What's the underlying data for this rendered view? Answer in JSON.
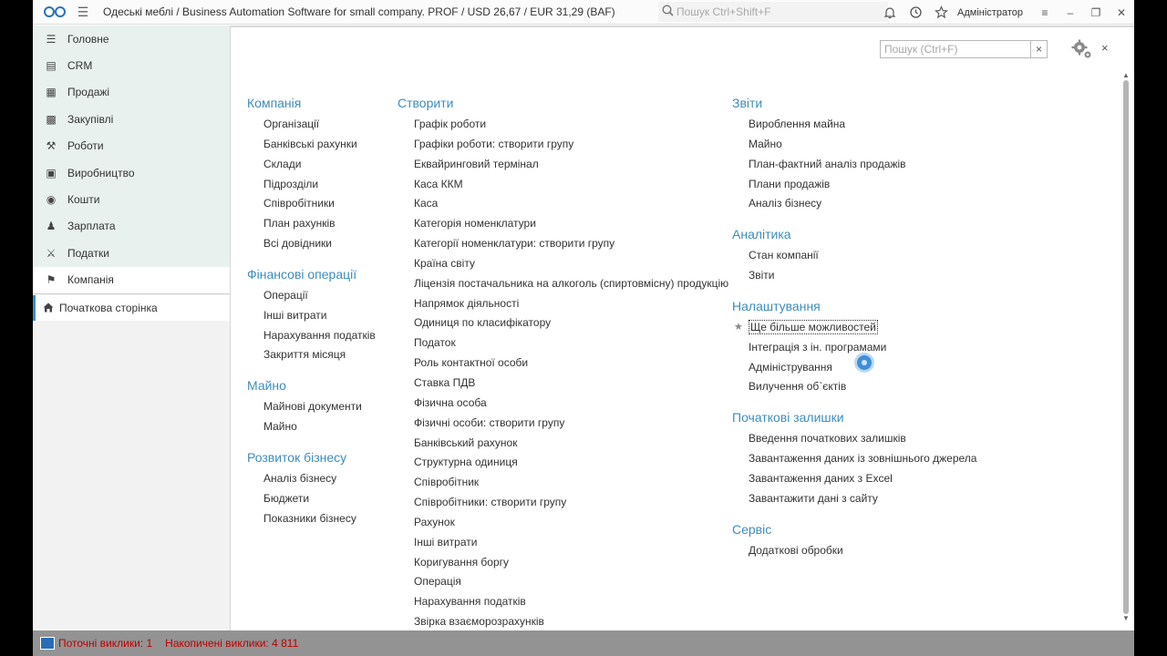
{
  "titlebar": {
    "app_title": "Одеські меблі / Business Automation Software for small company. PROF / USD 26,67 / EUR 31,29  (BAF)",
    "search_placeholder": "Пошук Ctrl+Shift+F",
    "user": "Адміністратор"
  },
  "sidebar": {
    "sections": [
      {
        "label": "Головне",
        "icon": "list-icon"
      },
      {
        "label": "CRM",
        "icon": "crm-icon"
      },
      {
        "label": "Продажі",
        "icon": "basket-icon"
      },
      {
        "label": "Закупівлі",
        "icon": "purchases-icon"
      },
      {
        "label": "Роботи",
        "icon": "tools-icon"
      },
      {
        "label": "Виробництво",
        "icon": "factory-icon"
      },
      {
        "label": "Кошти",
        "icon": "coin-icon"
      },
      {
        "label": "Зарплата",
        "icon": "people-icon"
      },
      {
        "label": "Податки",
        "icon": "tax-icon"
      },
      {
        "label": "Компанія",
        "icon": "flag-icon"
      }
    ],
    "active_section": "Компанія",
    "open_window": "Початкова сторінка"
  },
  "panel": {
    "search_placeholder": "Пошук (Ctrl+F)",
    "clear_label": "×",
    "close_label": "×"
  },
  "columns": [
    [
      {
        "title": "Компанія",
        "links": [
          "Організації",
          "Банківські рахунки",
          "Склади",
          "Підрозділи",
          "Співробітники",
          "План рахунків",
          "Всі довідники"
        ]
      },
      {
        "title": "Фінансові операції",
        "links": [
          "Операції",
          "Інші витрати",
          "Нарахування податків",
          "Закриття місяця"
        ]
      },
      {
        "title": "Майно",
        "links": [
          "Майнові документи",
          "Майно"
        ]
      },
      {
        "title": "Розвиток бізнесу",
        "links": [
          "Аналіз бізнесу",
          "Бюджети",
          "Показники бізнесу"
        ]
      }
    ],
    [
      {
        "title": "Створити",
        "links": [
          "Графік роботи",
          "Графіки роботи: створити групу",
          "Еквайринговий термінал",
          "Каса ККМ",
          "Каса",
          "Категорія номенклатури",
          "Категорії номенклатури: створити групу",
          "Країна світу",
          "Ліцензія постачальника на алкоголь (спиртовмісну) продукцію",
          "Напрямок діяльності",
          "Одиниця по класифікатору",
          "Податок",
          "Роль контактної особи",
          "Ставка ПДВ",
          "Фізична особа",
          "Фізичні особи: створити групу",
          "Банківський рахунок",
          "Структурна одиниця",
          "Співробітник",
          "Співробітники: створити групу",
          "Рахунок",
          "Інші витрати",
          "Коригування боргу",
          "Операція",
          "Нарахування податків",
          "Звірка взаєморозрахунків"
        ]
      }
    ],
    [
      {
        "title": "Звіти",
        "links": [
          "Вироблення майна",
          "Майно",
          "План-фактний аналіз продажів",
          "Плани продажів",
          "Аналіз бізнесу"
        ]
      },
      {
        "title": "Аналітика",
        "links": [
          "Стан компанії",
          "Звіти"
        ]
      },
      {
        "title": "Налаштування",
        "links": [
          "Ще більше можливостей",
          "Інтеграція з ін. програмами",
          "Адміністрування",
          "Вилучення об`єктів"
        ]
      },
      {
        "title": "Початкові залишки",
        "links": [
          "Введення початкових залишків",
          "Завантаження даних із зовнішнього джерела",
          "Завантаження даних з Excel",
          "Завантажити дані з сайту"
        ]
      },
      {
        "title": "Сервіс",
        "links": [
          "Додаткові обробки"
        ]
      }
    ]
  ],
  "statusbar": {
    "current_calls": "Поточні виклики: 1",
    "accumulated_calls": "Накопичені виклики: 4 811"
  }
}
